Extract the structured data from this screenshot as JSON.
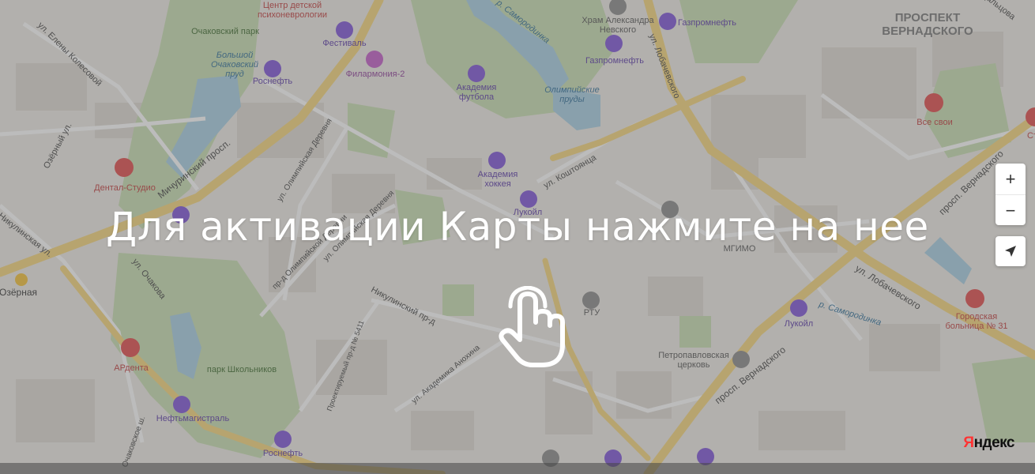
{
  "overlay": {
    "message": "Для активации Карты нажмите на нее"
  },
  "controls": {
    "zoom_in": "+",
    "zoom_out": "−"
  },
  "logo": {
    "first_letter": "Я",
    "rest": "ндекс"
  },
  "labels": {
    "center_psycho": "Центр детской\nпсихоневрологии",
    "ochakovsky_park": "Очаковский парк",
    "bolshoy_prud": "Большой\nОчаковский\nпруд",
    "festival": "Фестиваль",
    "philharmonia": "Филармония-2",
    "rosneft_top": "Роснефть",
    "samorodinka_top": "р. Самородинка",
    "akademia_futbola": "Академия\nфутбола",
    "olimpiyskie_prudy": "Олимпийские\nпруды",
    "hram": "Храм Александра\nНевского",
    "gazpromneft_1": "Газпромнефть",
    "gazpromneft_2": "Газпромнефть",
    "prospekt_vernadskogo_district": "ПРОСПЕКТ\nВЕРНАДСКОГО",
    "dalcova": "Дальцова",
    "ul_eleny_kolesovoy": "ул. Елены Колесовой",
    "ul_lobachevskogo_top": "ул. Лобачевского",
    "vse_svoi": "Все свои",
    "sto": "Сто",
    "ozyorny_ul": "Озёрный ул.",
    "michurinsky": "Мичуринский просп.",
    "ul_olimpiyskaya_derevnya": "ул. Олимпийская Деревня",
    "akademia_hokkeya": "Академия\nхоккея",
    "ul_koshtoyantsa": "ул. Коштоянца",
    "prosp_vernadskogo_right": "просп. Вернадского",
    "dental_studio": "Дентал-Студио",
    "lukoil_1": "Лукойл",
    "nikulinskaya": "Никулинская ул.",
    "olimpiyskaya_derevnya_bottom": "ул. Олимпийская Деревня",
    "pr_olimpiyskoy": "пр-д Олимпийской Деревни",
    "mgimo": "МГИМО",
    "ul_lobachevskogo_right": "ул. Лобачевского",
    "metro_ozernaya": "Озёрная",
    "ul_ochakova": "ул. Очакова",
    "nikulinsky_prd": "Никулинский пр-д",
    "rtu": "РТУ",
    "samorodinka_bottom": "р. Самородинка",
    "lukoil_2": "Лукойл",
    "gorodskaya_bolnica": "Городская\nбольница № 31",
    "proektiruemy": "Проектируемый пр-д № 5411",
    "ardenta": "АРдента",
    "park_shkolnikov": "парк Школьников",
    "ul_akademika_anohina": "ул. Академика Анохина",
    "petropavlovskaya": "Петропавловская\nцерковь",
    "prosp_vernadskogo_bottom": "просп. Вернадского",
    "neftmagistral": "Нефтьмагистраль",
    "rosneft_bottom": "Роснефть",
    "ochakovskoe_sh": "Очаковское ш."
  },
  "colors": {
    "land": "#eeebe5",
    "park": "#c9dfb1",
    "water": "#a8cfe3",
    "road_major": "#f7d67a",
    "road_minor": "#ffffff",
    "building": "#dedad3",
    "poi_purple": "#7e54d8",
    "poi_red": "#e24a4a",
    "overlay": "#5f5f5f"
  }
}
